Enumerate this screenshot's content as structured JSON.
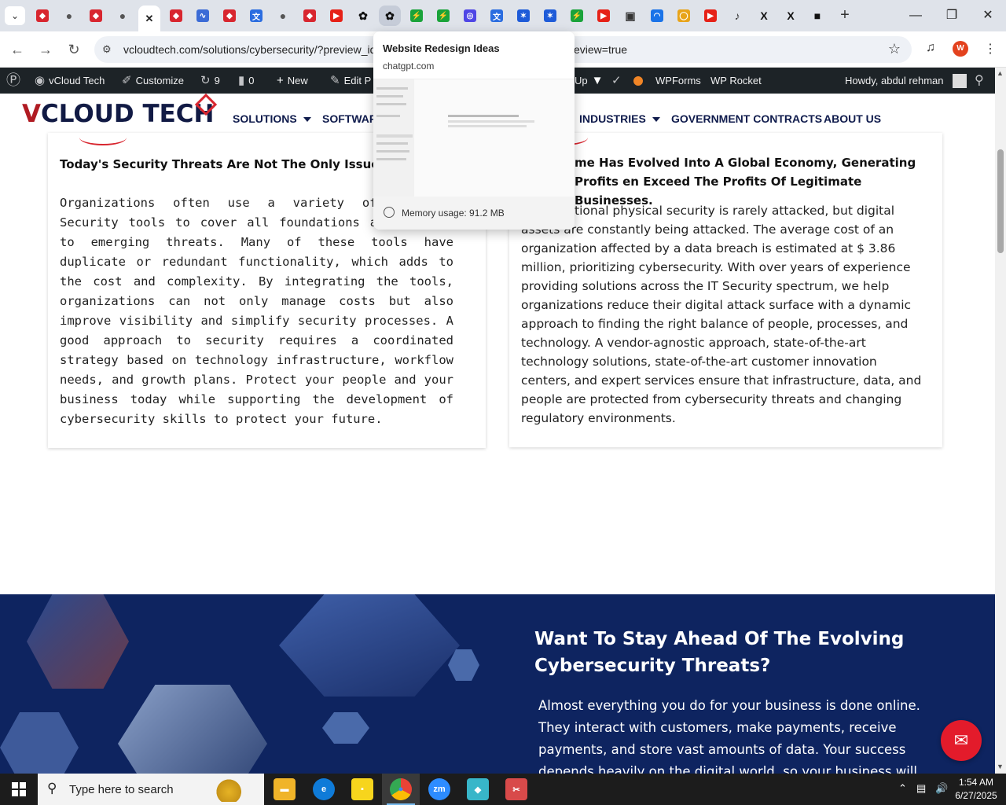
{
  "browser": {
    "tabs": [
      {
        "icon": "diamond-icon",
        "color": "#d8262f"
      },
      {
        "icon": "globe-icon",
        "color": "#555555"
      },
      {
        "icon": "diamond-icon",
        "color": "#d8262f"
      },
      {
        "icon": "globe-icon",
        "color": "#555555"
      },
      {
        "icon": "close-icon",
        "color": "#222222",
        "active": true
      },
      {
        "icon": "diamond-icon",
        "color": "#d8262f"
      },
      {
        "icon": "wave-icon",
        "color": "#3b6bd6"
      },
      {
        "icon": "diamond-icon",
        "color": "#d8262f"
      },
      {
        "icon": "translate-icon",
        "color": "#2b6de0"
      },
      {
        "icon": "globe-icon",
        "color": "#555555"
      },
      {
        "icon": "diamond-icon",
        "color": "#d8262f"
      },
      {
        "icon": "youtube-icon",
        "color": "#e62117"
      },
      {
        "icon": "openai-icon",
        "color": "#111111"
      },
      {
        "icon": "openai-icon",
        "color": "#111111",
        "hover": true
      },
      {
        "icon": "bolt-icon",
        "color": "#1aa33a"
      },
      {
        "icon": "bolt-icon",
        "color": "#1aa33a"
      },
      {
        "icon": "spiral-icon",
        "color": "#4f46e5"
      },
      {
        "icon": "translate-icon",
        "color": "#2b6de0"
      },
      {
        "icon": "puzzle-icon",
        "color": "#1e5bd8"
      },
      {
        "icon": "puzzle-icon",
        "color": "#1e5bd8"
      },
      {
        "icon": "bolt-icon",
        "color": "#1aa33a"
      },
      {
        "icon": "youtube-icon",
        "color": "#e62117"
      },
      {
        "icon": "lock-icon",
        "color": "#333333"
      },
      {
        "icon": "cloud-icon",
        "color": "#1a73e8"
      },
      {
        "icon": "ring-icon",
        "color": "#e8a41a"
      },
      {
        "icon": "youtube-icon",
        "color": "#e62117"
      },
      {
        "icon": "speaker-icon",
        "color": "#333333"
      },
      {
        "icon": "x-icon",
        "color": "#111111"
      },
      {
        "icon": "x-icon",
        "color": "#111111"
      },
      {
        "icon": "square-logo-icon",
        "color": "#111111"
      }
    ],
    "url": "vcloudtech.com/solutions/cybersecurity/?preview_id",
    "url_tail": "eview=true",
    "profile_initial": "W"
  },
  "hovercard": {
    "title": "Website Redesign Ideas",
    "domain": "chatgpt.com",
    "memory": "Memory usage: 91.2 MB"
  },
  "adminbar": {
    "site": "vCloud Tech",
    "customize": "Customize",
    "updates": "9",
    "comments": "0",
    "new": "New",
    "edit": "Edit P",
    "up": "Up",
    "wpforms": "WPForms",
    "wprocket": "WP Rocket",
    "howdy": "Howdy, abdul rehman"
  },
  "site": {
    "logo_v": "V",
    "logo_rest": "CLOUD TECH",
    "nav": {
      "solutions": "SOLUTIONS",
      "software": "SOFTWAR",
      "industries": "INDUSTRIES",
      "gov": "GOVERNMENT CONTRACTS",
      "about": "ABOUT US"
    }
  },
  "cards": {
    "left": {
      "title": "Today's Security Threats Are Not The Only Issue",
      "body": "Organizations often use a variety of Computer Security tools to cover all foundations and respond to emerging threats. Many of these tools have duplicate or redundant functionality, which adds to the cost and complexity. By integrating the tools, organizations can not only manage costs but also improve visibility and simplify security processes. A good approach to security requires a coordinated strategy based on technology infrastructure, workflow needs, and growth plans. Protect your people and your business today while supporting the development of cybersecurity skills to protect your future."
    },
    "right": {
      "title": "me Has Evolved Into A Global Economy, Generating Profits en Exceed The Profits Of Legitimate Businesses.",
      "body": "tional physical security is rarely attacked, but digital assets are constantly being attacked. The average cost of an organization affected by a data breach is estimated at $ 3.86 million, prioritizing cybersecurity. With over years of experience providing solutions across the IT Security spectrum, we help organizations reduce their digital attack surface with a dynamic approach to finding the right balance of people, processes, and technology. A vendor-agnostic approach, state-of-the-art technology solutions, state-of-the-art customer innovation centers, and expert services ensure that infrastructure, data, and people are protected from cybersecurity threats and changing regulatory environments."
    }
  },
  "cta": {
    "heading": "Want To Stay Ahead Of The Evolving Cybersecurity Threats?",
    "body": "Almost everything you do for your business is done online. They interact with customers, make payments, receive payments, and store vast amounts of data. Your success depends heavily on the digital world, so your business will"
  },
  "taskbar": {
    "search_placeholder": "Type here to search",
    "time": "1:54 AM",
    "date": "6/27/2025",
    "apps": [
      {
        "icon": "file-explorer-icon",
        "color": "#f0b429"
      },
      {
        "icon": "edge-icon",
        "color": "#0f7bd8"
      },
      {
        "icon": "sticky-notes-icon",
        "color": "#f7d51d"
      },
      {
        "icon": "chrome-icon",
        "color": "#34a853",
        "active": true
      },
      {
        "icon": "zoom-icon",
        "color": "#2d8cff"
      },
      {
        "icon": "gem-icon",
        "color": "#38b6c9"
      },
      {
        "icon": "snipping-icon",
        "color": "#d84a4a"
      }
    ]
  }
}
